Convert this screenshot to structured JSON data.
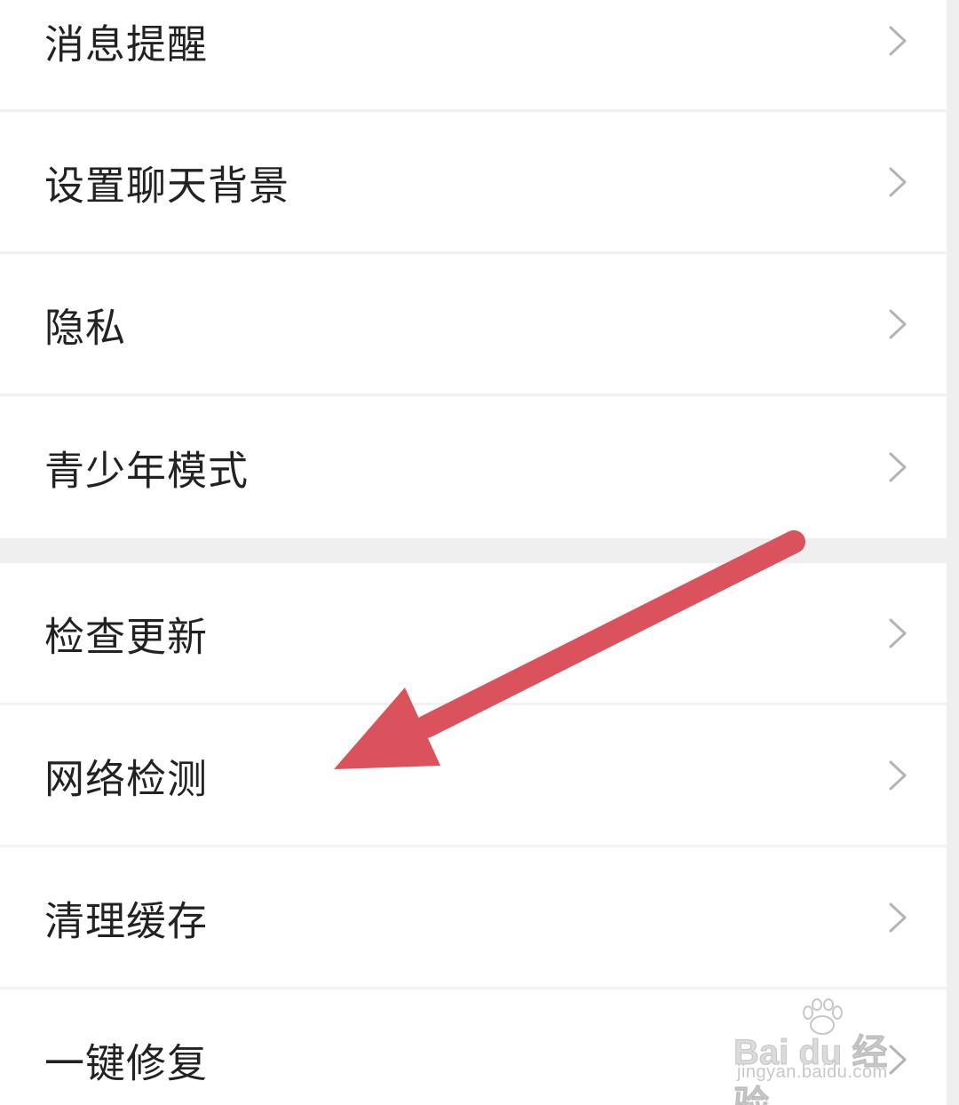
{
  "settings": {
    "group1": [
      {
        "label": "消息提醒"
      },
      {
        "label": "设置聊天背景"
      },
      {
        "label": "隐私"
      },
      {
        "label": "青少年模式"
      }
    ],
    "group2": [
      {
        "label": "检查更新"
      },
      {
        "label": "网络检测"
      },
      {
        "label": "清理缓存"
      },
      {
        "label": "一键修复"
      }
    ]
  },
  "annotation": {
    "arrow_color": "#d9525c",
    "target": "网络检测"
  },
  "watermark": {
    "logo": "Bai du 经验",
    "url": "jingyan.baidu.com"
  },
  "icons": {
    "row_chevron": "chevron-right-icon"
  }
}
